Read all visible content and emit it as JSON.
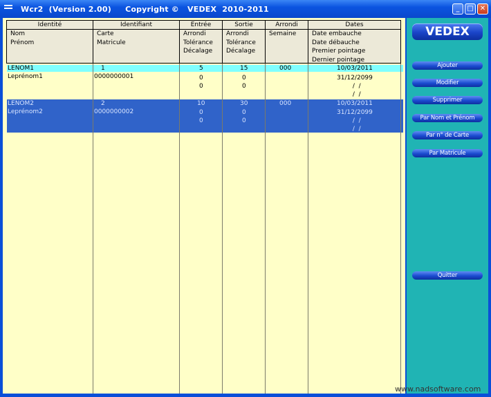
{
  "window": {
    "title": "Wcr2  (Version 2.00)     Copyright ©   VEDEX  2010-2011",
    "controls": {
      "minimize": "_",
      "maximize": "□",
      "close": "✕"
    }
  },
  "columns": [
    {
      "caption": "Identité",
      "sub": [
        "Nom",
        "Prénom"
      ]
    },
    {
      "caption": "Identifiant",
      "sub": [
        "Carte",
        "Matricule"
      ]
    },
    {
      "caption": "Entrée",
      "sub": [
        "Arrondi",
        "Tolérance",
        "Décalage"
      ]
    },
    {
      "caption": "Sortie",
      "sub": [
        "Arrondi",
        "Tolérance",
        "Décalage"
      ]
    },
    {
      "caption": "Arrondi",
      "sub": [
        "Semaine"
      ]
    },
    {
      "caption": "Dates",
      "sub": [
        "Date embauche",
        "Date débauche",
        "Premier pointage",
        "Dernier pointage"
      ]
    }
  ],
  "rows": [
    {
      "nom": "LENOM1",
      "prenom": "Leprénom1",
      "carte": "1",
      "matricule": "0000000001",
      "entree": [
        "5",
        "0",
        "0"
      ],
      "sortie": [
        "15",
        "0",
        "0"
      ],
      "semaine": "000",
      "dates": [
        "10/03/2011",
        "31/12/2099",
        " /  /",
        " /  /"
      ]
    },
    {
      "nom": "LENOM2",
      "prenom": "Leprénom2",
      "carte": "2",
      "matricule": "0000000002",
      "entree": [
        "10",
        "0",
        "0"
      ],
      "sortie": [
        "30",
        "0",
        "0"
      ],
      "semaine": "000",
      "dates": [
        "10/03/2011",
        "31/12/2099",
        " /  /",
        " /  /"
      ]
    }
  ],
  "sidebar": {
    "brand": "VEDEX",
    "buttons": [
      "Ajouter",
      "Modifier",
      "Supprimer",
      "Par Nom et Prénom",
      "Par n° de Carte",
      "Par Matricule"
    ],
    "quit": "Quitter"
  },
  "footer": "www.nadsoftware.com"
}
